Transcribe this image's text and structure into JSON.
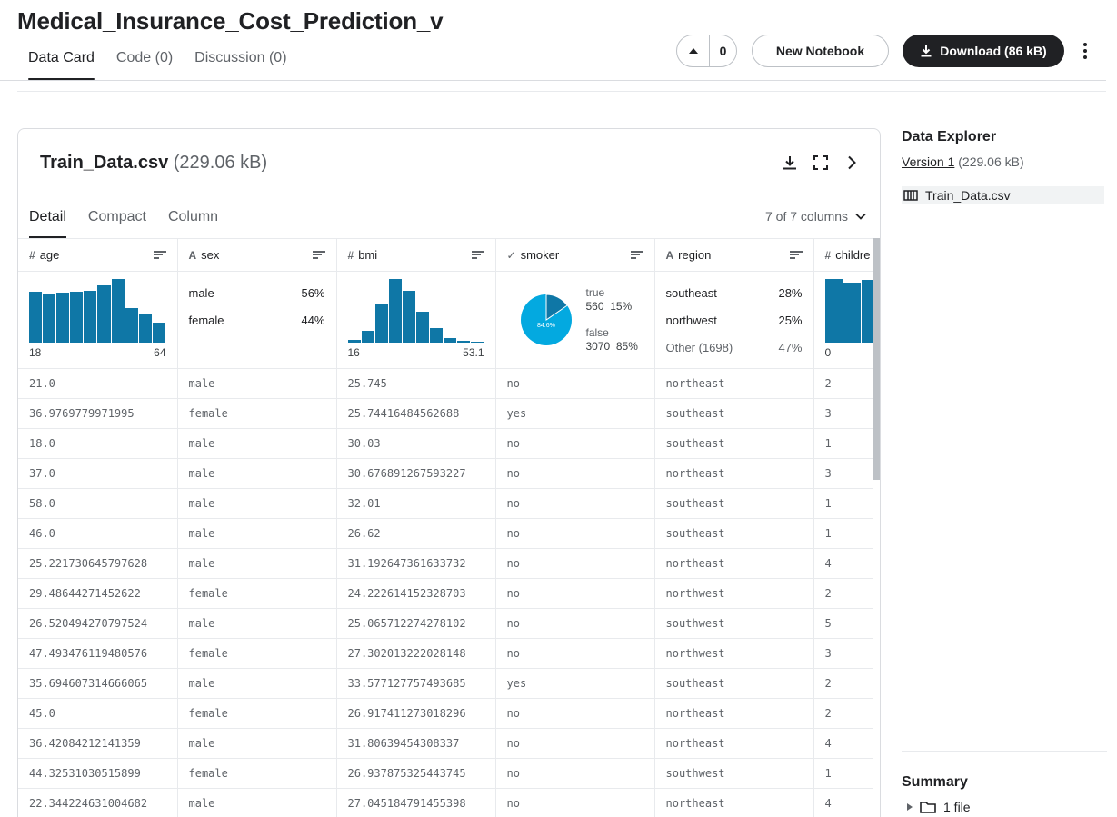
{
  "header": {
    "title": "Medical_Insurance_Cost_Prediction_v",
    "tabs": [
      {
        "label": "Data Card"
      },
      {
        "label": "Code (0)"
      },
      {
        "label": "Discussion (0)"
      }
    ],
    "vote_count": "0",
    "new_notebook_label": "New Notebook",
    "download_label": "Download (86 kB)"
  },
  "file": {
    "name": "Train_Data.csv",
    "size": "(229.06 kB)",
    "view_tabs": [
      "Detail",
      "Compact",
      "Column"
    ],
    "column_count": "7 of 7 columns"
  },
  "columns": [
    {
      "name": "age",
      "type": "#"
    },
    {
      "name": "sex",
      "type": "A"
    },
    {
      "name": "bmi",
      "type": "#"
    },
    {
      "name": "smoker",
      "type": "✓"
    },
    {
      "name": "region",
      "type": "A"
    },
    {
      "name": "childre",
      "type": "#"
    }
  ],
  "summary": {
    "age": {
      "min": "18",
      "max": "64",
      "hist": [
        0.8,
        0.76,
        0.78,
        0.8,
        0.82,
        0.9,
        1.0,
        0.55,
        0.45,
        0.32
      ]
    },
    "sex": [
      {
        "label": "male",
        "pct": "56%"
      },
      {
        "label": "female",
        "pct": "44%"
      }
    ],
    "bmi": {
      "min": "16",
      "max": "53.1",
      "hist": [
        0.04,
        0.18,
        0.62,
        1.0,
        0.82,
        0.48,
        0.23,
        0.07,
        0.03,
        0.01
      ]
    },
    "smoker": {
      "true_label": "true",
      "true_count": "560",
      "true_pct": "15%",
      "false_label": "false",
      "false_count": "3070",
      "false_pct": "85%",
      "false_fraction": 0.846,
      "pie_label": "84.6%",
      "colors": {
        "false": "#03a9e0",
        "true": "#0f77a6"
      }
    },
    "region": [
      {
        "label": "southeast",
        "pct": "28%"
      },
      {
        "label": "northwest",
        "pct": "25%"
      },
      {
        "label": "Other (1698)",
        "pct": "47%"
      }
    ],
    "children": {
      "min": "0",
      "hist": [
        1.0,
        0.95,
        0.98
      ]
    }
  },
  "rows": [
    [
      "21.0",
      "male",
      "25.745",
      "no",
      "northeast",
      "2"
    ],
    [
      "36.9769779971995",
      "female",
      "25.74416484562688",
      "yes",
      "southeast",
      "3"
    ],
    [
      "18.0",
      "male",
      "30.03",
      "no",
      "southeast",
      "1"
    ],
    [
      "37.0",
      "male",
      "30.676891267593227",
      "no",
      "northeast",
      "3"
    ],
    [
      "58.0",
      "male",
      "32.01",
      "no",
      "southeast",
      "1"
    ],
    [
      "46.0",
      "male",
      "26.62",
      "no",
      "southeast",
      "1"
    ],
    [
      "25.221730645797628",
      "male",
      "31.192647361633732",
      "no",
      "northeast",
      "4"
    ],
    [
      "29.48644271452622",
      "female",
      "24.222614152328703",
      "no",
      "northwest",
      "2"
    ],
    [
      "26.520494270797524",
      "male",
      "25.065712274278102",
      "no",
      "southwest",
      "5"
    ],
    [
      "47.493476119480576",
      "female",
      "27.302013222028148",
      "no",
      "northwest",
      "3"
    ],
    [
      "35.694607314666065",
      "male",
      "33.577127757493685",
      "yes",
      "southeast",
      "2"
    ],
    [
      "45.0",
      "female",
      "26.917411273018296",
      "no",
      "northeast",
      "2"
    ],
    [
      "36.42084212141359",
      "male",
      "31.80639454308337",
      "no",
      "northeast",
      "4"
    ],
    [
      "44.32531030515899",
      "female",
      "26.937875325443745",
      "no",
      "southwest",
      "1"
    ],
    [
      "22.344224631004682",
      "male",
      "27.045184791455398",
      "no",
      "northeast",
      "4"
    ]
  ],
  "sidebar": {
    "title": "Data Explorer",
    "version_link": "Version 1",
    "version_size": "(229.06 kB)",
    "file_name": "Train_Data.csv",
    "summary_title": "Summary",
    "files_count": "1 file"
  },
  "colors": {
    "accent": "#202124",
    "bar": "#0f77a6"
  }
}
